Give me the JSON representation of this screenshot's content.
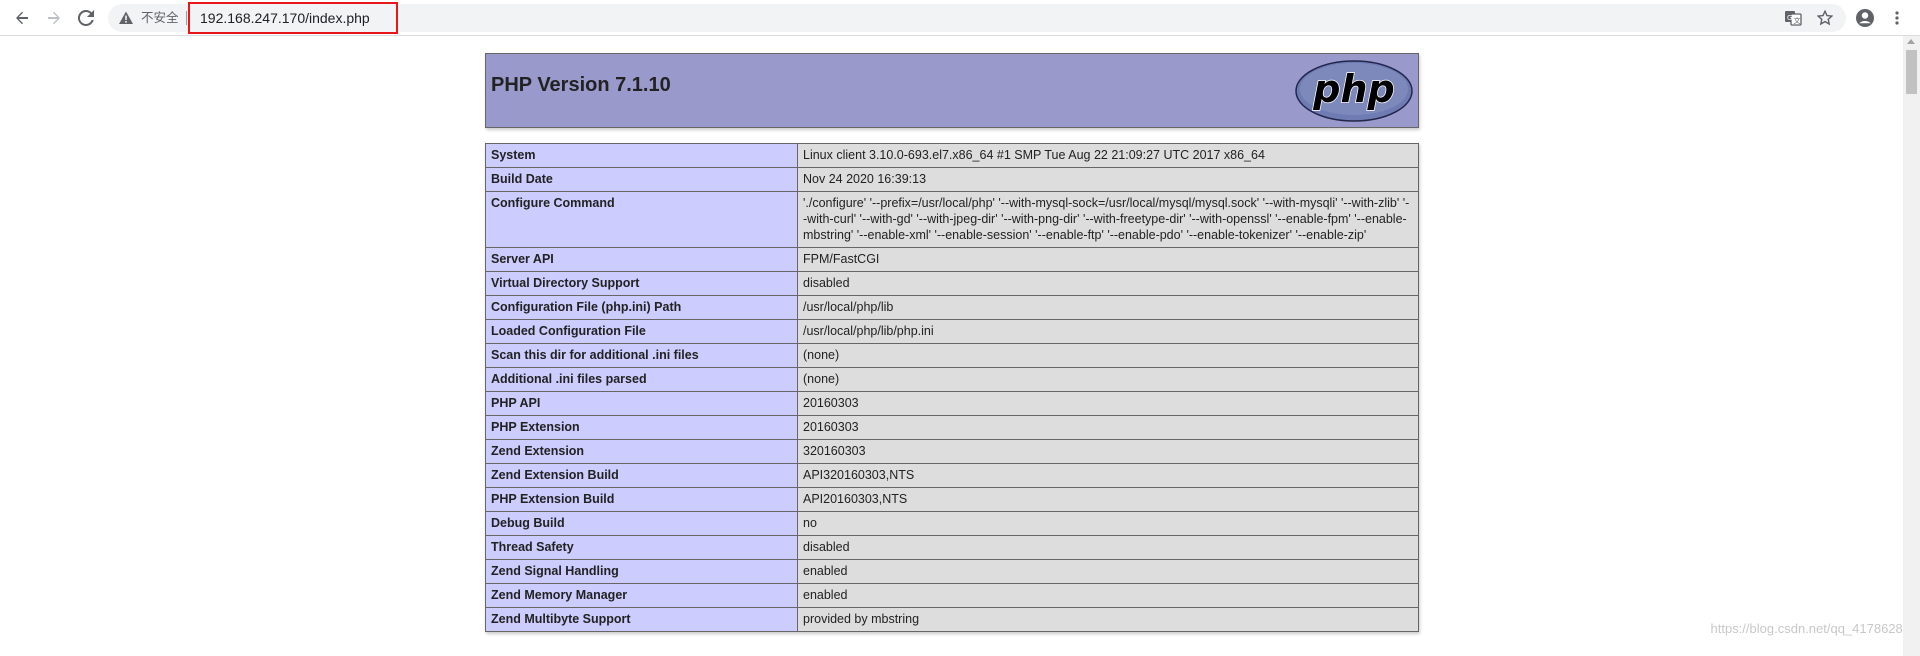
{
  "browser": {
    "insecure_label": "不安全",
    "url": "192.168.247.170/index.php"
  },
  "header": {
    "title": "PHP Version 7.1.10",
    "logo_text": "php"
  },
  "rows": [
    {
      "label": "System",
      "value": "Linux client 3.10.0-693.el7.x86_64 #1 SMP Tue Aug 22 21:09:27 UTC 2017 x86_64"
    },
    {
      "label": "Build Date",
      "value": "Nov 24 2020 16:39:13"
    },
    {
      "label": "Configure Command",
      "value": "'./configure' '--prefix=/usr/local/php' '--with-mysql-sock=/usr/local/mysql/mysql.sock' '--with-mysqli' '--with-zlib' '--with-curl' '--with-gd' '--with-jpeg-dir' '--with-png-dir' '--with-freetype-dir' '--with-openssl' '--enable-fpm' '--enable-mbstring' '--enable-xml' '--enable-session' '--enable-ftp' '--enable-pdo' '--enable-tokenizer' '--enable-zip'"
    },
    {
      "label": "Server API",
      "value": "FPM/FastCGI"
    },
    {
      "label": "Virtual Directory Support",
      "value": "disabled"
    },
    {
      "label": "Configuration File (php.ini) Path",
      "value": "/usr/local/php/lib"
    },
    {
      "label": "Loaded Configuration File",
      "value": "/usr/local/php/lib/php.ini"
    },
    {
      "label": "Scan this dir for additional .ini files",
      "value": "(none)"
    },
    {
      "label": "Additional .ini files parsed",
      "value": "(none)"
    },
    {
      "label": "PHP API",
      "value": "20160303"
    },
    {
      "label": "PHP Extension",
      "value": "20160303"
    },
    {
      "label": "Zend Extension",
      "value": "320160303"
    },
    {
      "label": "Zend Extension Build",
      "value": "API320160303,NTS"
    },
    {
      "label": "PHP Extension Build",
      "value": "API20160303,NTS"
    },
    {
      "label": "Debug Build",
      "value": "no"
    },
    {
      "label": "Thread Safety",
      "value": "disabled"
    },
    {
      "label": "Zend Signal Handling",
      "value": "enabled"
    },
    {
      "label": "Zend Memory Manager",
      "value": "enabled"
    },
    {
      "label": "Zend Multibyte Support",
      "value": "provided by mbstring"
    }
  ],
  "watermark": "https://blog.csdn.net/qq_41786285",
  "colors": {
    "header_bg": "#9999cc",
    "label_bg": "#ccccff",
    "value_bg": "#dddddd",
    "highlight": "#e8151b"
  }
}
